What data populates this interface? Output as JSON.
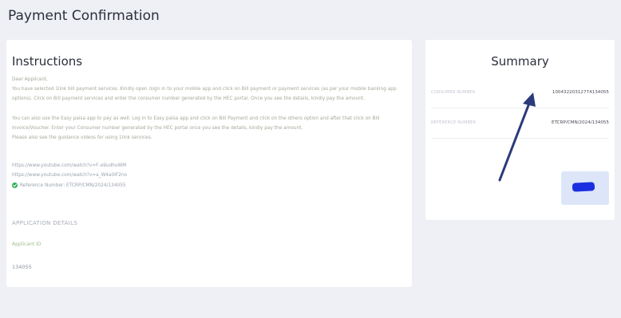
{
  "page": {
    "title": "Payment Confirmation"
  },
  "instructions": {
    "heading": "Instructions",
    "greeting": "Dear Applicant,",
    "paragraph1": "You have selected 1link bill payment services. Kindly open /sign in to your mobile app and click on Bill payment or payment services (as per your mobile banking app options). Click on Bill payment services and enter the consumer number generated by the HEC portal. Once you see the details, kindly pay the amount.",
    "paragraph2": "You can also use the Easy paisa app to pay as well. Log in to Easy paisa app and click on Bill Payment and click on the others option and after that click on Bill Invoice/Voucher. Enter your Consumer number generated by the HEC portal once you see the details, kindly pay the amount.",
    "paragraph3": "Please also see the guidance videos for using 1link services.",
    "links": [
      "https://www.youtube.com/watch?v=F-a9udhuWM",
      "https://www.youtube.com/watch?v=a_W4a0IF2no"
    ],
    "reference_line": "Reference Number: ETCRP/CMN/2024/134055",
    "application_details_title": "APPLICATION DETAILS",
    "applicant_id_label": "Applicant ID",
    "applicant_id_value": "134055"
  },
  "summary": {
    "heading": "Summary",
    "rows": [
      {
        "label": "CONSUMER NUMBER",
        "value": "1004322031277413405​5"
      },
      {
        "label": "REFERENCE NUMBER",
        "value": "ETCRP/CMN/2024/134055"
      }
    ]
  },
  "colors": {
    "background": "#eef0f6",
    "card": "#ffffff",
    "annotation_arrow": "#2a3a7a",
    "redaction": "#1b2fe0",
    "check": "#2eae57"
  }
}
